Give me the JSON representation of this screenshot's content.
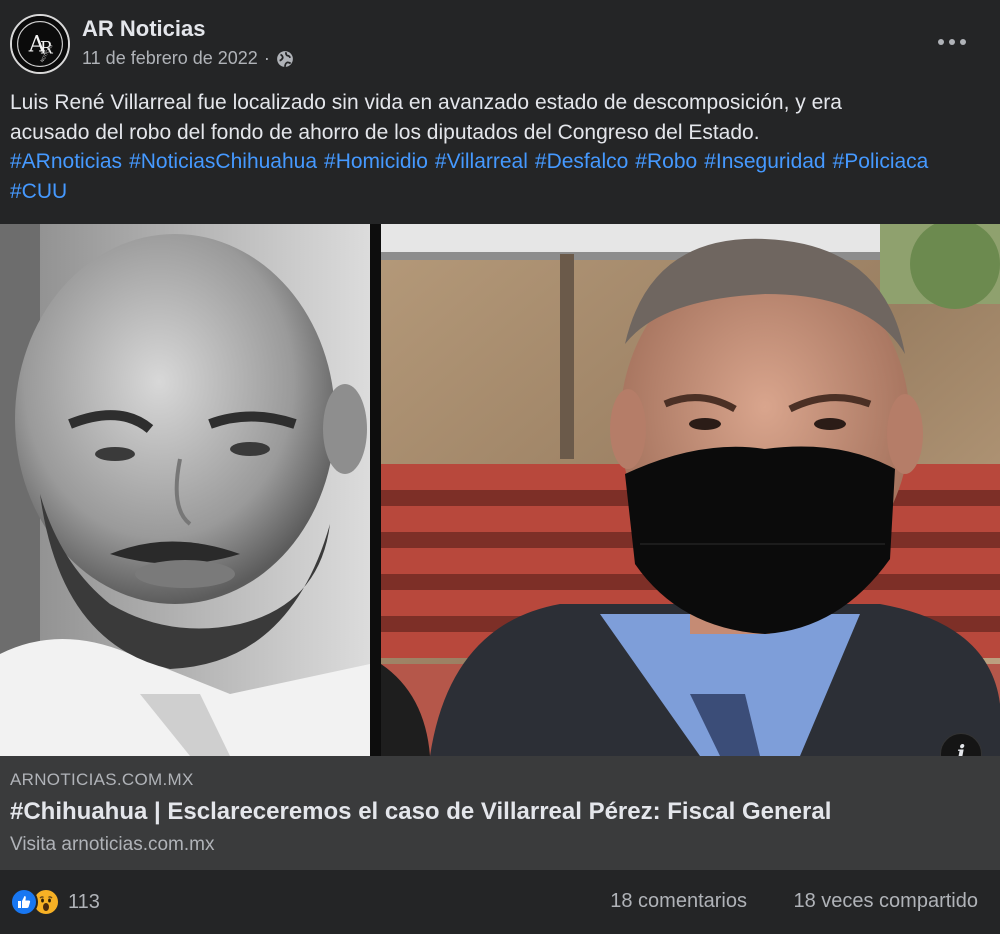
{
  "post": {
    "page_name": "AR Noticias",
    "date": "11 de febrero de 2022",
    "separator": "·",
    "privacy_icon": "globe-icon",
    "more_icon": "more-options-icon",
    "avatar_logo_letters": "AR",
    "avatar_logo_subtext": "NOTICIAS",
    "text_line_1": "Luis René Villarreal fue localizado sin vida en avanzado estado de descomposición, y era",
    "text_line_2": "acusado del robo del fondo de ahorro de los diputados del Congreso del Estado.",
    "hashtags": [
      "#ARnoticias",
      "#NoticiasChihuahua",
      "#Homicidio",
      "#Villarreal",
      "#Desfalco",
      "#Robo",
      "#Inseguridad",
      "#Policiaca",
      "#CUU"
    ]
  },
  "link_preview": {
    "domain": "ARNOTICIAS.COM.MX",
    "title": "#Chihuahua | Esclareceremos el caso de Villarreal Pérez: Fiscal General",
    "subtitle": "Visita arnoticias.com.mx",
    "info_icon": "info-icon",
    "info_label": "i"
  },
  "reactions": {
    "icons": [
      "like-icon",
      "wow-icon"
    ],
    "count": "113",
    "comments": "18 comentarios",
    "shares": "18 veces compartido"
  },
  "colors": {
    "background": "#242526",
    "link_card": "#3a3b3c",
    "hashtag": "#4599ff",
    "text_primary": "#e4e6eb",
    "text_secondary": "#b0b3b8",
    "like_blue": "#1877f2",
    "wow_yellow": "#f7b125"
  }
}
